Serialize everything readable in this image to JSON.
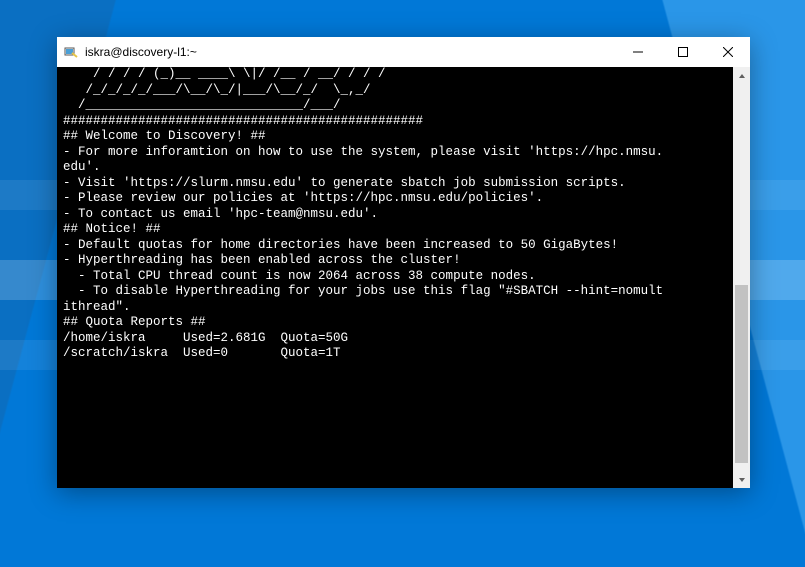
{
  "window": {
    "title": "iskra@discovery-l1:~"
  },
  "terminal": {
    "ascii1": "    / / / / (_)__ ____\\ \\|/ /__ / __/ / / /",
    "ascii2": "   /_/_/_/_/___/\\__/\\_/|___/\\__/_/  \\_,_/",
    "ascii3": "  /_____________________________/___/",
    "hashline": "################################################",
    "welcome_header": "## Welcome to Discovery! ##",
    "welcome_l1a": "- For more inforamtion on how to use the system, please visit 'https://hpc.nmsu.",
    "welcome_l1b": "edu'.",
    "welcome_l2": "- Visit 'https://slurm.nmsu.edu' to generate sbatch job submission scripts.",
    "welcome_l3": "- Please review our policies at 'https://hpc.nmsu.edu/policies'.",
    "welcome_l4": "- To contact us email 'hpc-team@nmsu.edu'.",
    "notice_header": "## Notice! ##",
    "notice_l1": "- Default quotas for home directories have been increased to 50 GigaBytes!",
    "notice_l2": "- Hyperthreading has been enabled across the cluster!",
    "notice_l3": "  - Total CPU thread count is now 2064 across 38 compute nodes.",
    "notice_l4a": "  - To disable Hyperthreading for your jobs use this flag \"#SBATCH --hint=nomult",
    "notice_l4b": "ithread\".",
    "quota_header": "## Quota Reports ##",
    "quota_l1": "/home/iskra     Used=2.681G  Quota=50G",
    "quota_l2": "/scratch/iskra  Used=0       Quota=1T"
  }
}
